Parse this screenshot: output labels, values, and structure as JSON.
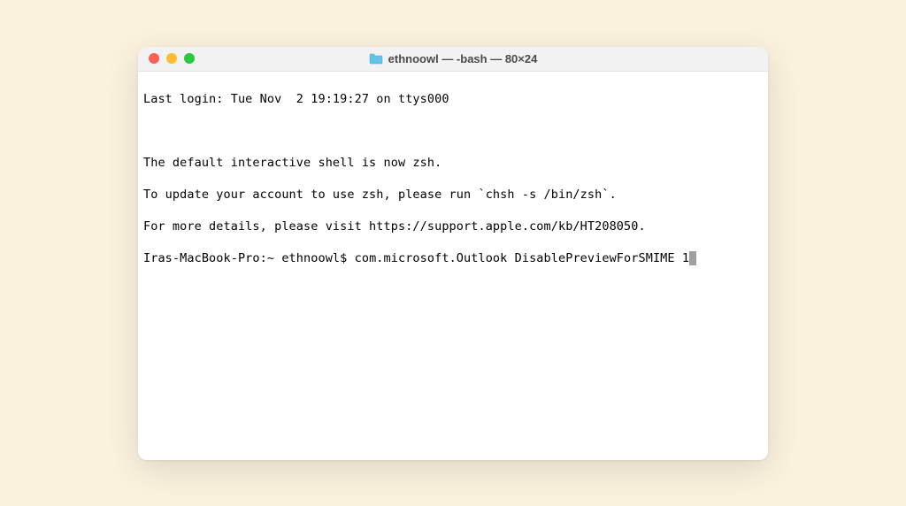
{
  "window": {
    "title": "ethnoowl — -bash — 80×24"
  },
  "terminal": {
    "line1": "Last login: Tue Nov  2 19:19:27 on ttys000",
    "line2": "The default interactive shell is now zsh.",
    "line3": "To update your account to use zsh, please run `chsh -s /bin/zsh`.",
    "line4": "For more details, please visit https://support.apple.com/kb/HT208050.",
    "prompt": "Iras-MacBook-Pro:~ ethnoowl$ ",
    "command": "com.microsoft.Outlook DisablePreviewForSMIME 1"
  }
}
